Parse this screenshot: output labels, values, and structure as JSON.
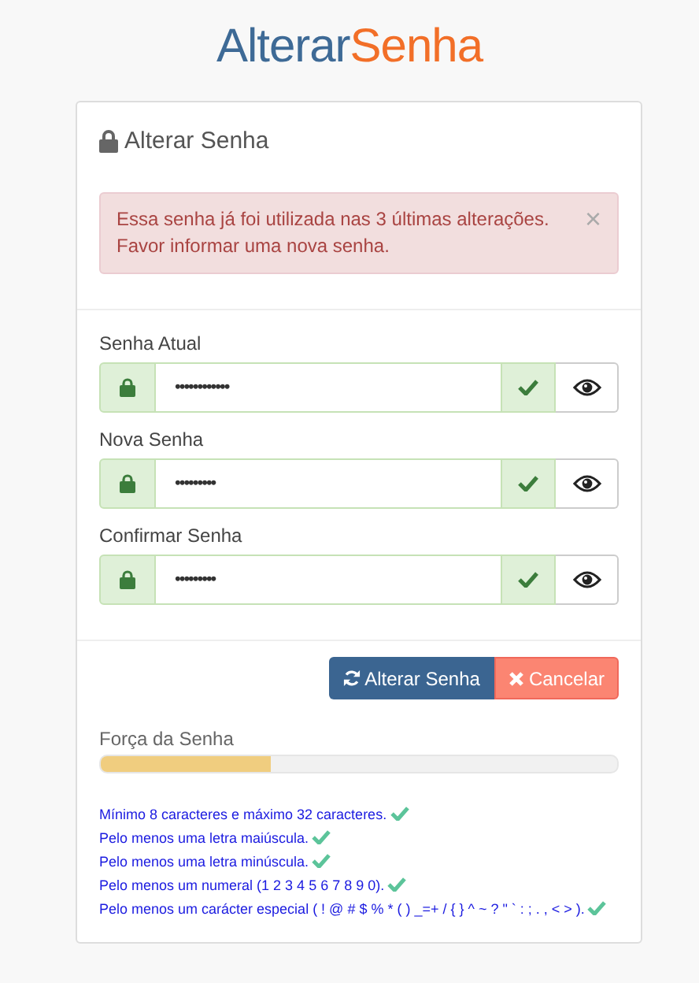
{
  "logo": {
    "part_1": "Alterar",
    "part_2": "Senha"
  },
  "panel": {
    "title": "Alterar Senha"
  },
  "alert": {
    "text": "Essa senha já foi utilizada nas 3 últimas alterações. Favor informar uma nova senha.",
    "close": "×"
  },
  "fields": [
    {
      "label": "Senha Atual",
      "value": "••••••••••••",
      "valid": true
    },
    {
      "label": "Nova Senha",
      "value": "•••••••••",
      "valid": true
    },
    {
      "label": "Confirmar Senha",
      "value": "•••••••••",
      "valid": true
    }
  ],
  "buttons": [
    {
      "label": "Alterar Senha",
      "kind": "primary"
    },
    {
      "label": "Cancelar",
      "kind": "cancel"
    }
  ],
  "strength": {
    "label": "Força da Senha",
    "level": 0.33
  },
  "rules": [
    {
      "text": "Mínimo 8 caracteres e máximo 32 caracteres.",
      "met": true
    },
    {
      "text": "Pelo menos uma letra maiúscula.",
      "met": true
    },
    {
      "text": "Pelo menos uma letra minúscula.",
      "met": true
    },
    {
      "text": "Pelo menos um numeral (1 2 3 4 5 6 7 8 9 0).",
      "met": true
    },
    {
      "text": "Pelo menos um carácter especial ( ! @ # $ % * ( ) _=+ / { } ^ ~ ? \" ` : ; . , < > ).",
      "met": true
    }
  ]
}
